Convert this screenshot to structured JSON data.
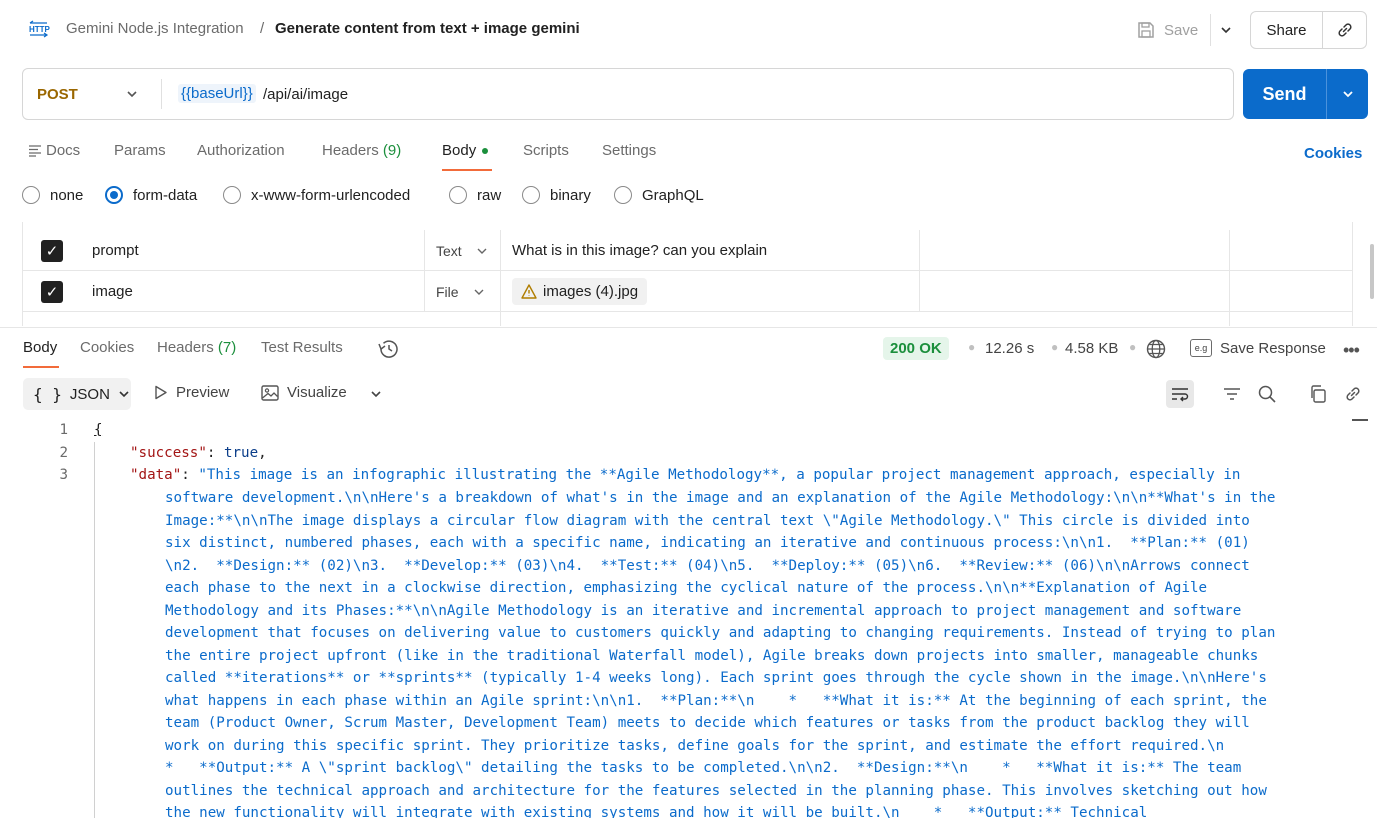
{
  "header": {
    "collection": "Gemini Node.js Integration",
    "separator": "/",
    "request_name": "Generate content from text + image gemini",
    "save_label": "Save",
    "share_label": "Share"
  },
  "request": {
    "method": "POST",
    "url_variable": "{{baseUrl}}",
    "url_path": "/api/ai/image",
    "send_label": "Send"
  },
  "request_tabs": [
    {
      "label": "Docs"
    },
    {
      "label": "Params"
    },
    {
      "label": "Authorization"
    },
    {
      "label": "Headers",
      "count": "(9)"
    },
    {
      "label": "Body",
      "active": true
    },
    {
      "label": "Scripts"
    },
    {
      "label": "Settings"
    }
  ],
  "cookies_label": "Cookies",
  "body_types": [
    "none",
    "form-data",
    "x-www-form-urlencoded",
    "raw",
    "binary",
    "GraphQL"
  ],
  "body_type_selected": "form-data",
  "form_rows": [
    {
      "checked": true,
      "key": "prompt",
      "type": "Text",
      "value": "What is in this image? can you explain"
    },
    {
      "checked": true,
      "key": "image",
      "type": "File",
      "value": "images (4).jpg"
    }
  ],
  "response": {
    "tabs": [
      {
        "label": "Body",
        "active": true
      },
      {
        "label": "Cookies"
      },
      {
        "label": "Headers",
        "count": "(7)"
      },
      {
        "label": "Test Results"
      }
    ],
    "status": "200 OK",
    "time": "12.26 s",
    "size": "4.58 KB",
    "save_response_label": "Save Response",
    "format": "JSON",
    "preview_label": "Preview",
    "visualize_label": "Visualize"
  },
  "code": {
    "line_numbers": [
      "1",
      "2",
      "3"
    ],
    "open_brace": "{",
    "success_key": "\"success\"",
    "success_value": "true",
    "data_key": "\"data\"",
    "data_lines": [
      "\"This image is an infographic illustrating the **Agile Methodology**, a popular project management approach, especially in",
      "software development.\\n\\nHere's a breakdown of what's in the image and an explanation of the Agile Methodology:\\n\\n**What's in the",
      "Image:**\\n\\nThe image displays a circular flow diagram with the central text \\\"Agile Methodology.\\\" This circle is divided into",
      "six distinct, numbered phases, each with a specific name, indicating an iterative and continuous process:\\n\\n1.  **Plan:** (01)",
      "\\n2.  **Design:** (02)\\n3.  **Develop:** (03)\\n4.  **Test:** (04)\\n5.  **Deploy:** (05)\\n6.  **Review:** (06)\\n\\nArrows connect",
      "each phase to the next in a clockwise direction, emphasizing the cyclical nature of the process.\\n\\n**Explanation of Agile",
      "Methodology and its Phases:**\\n\\nAgile Methodology is an iterative and incremental approach to project management and software",
      "development that focuses on delivering value to customers quickly and adapting to changing requirements. Instead of trying to plan",
      "the entire project upfront (like in the traditional Waterfall model), Agile breaks down projects into smaller, manageable chunks",
      "called **iterations** or **sprints** (typically 1-4 weeks long). Each sprint goes through the cycle shown in the image.\\n\\nHere's",
      "what happens in each phase within an Agile sprint:\\n\\n1.  **Plan:**\\n    *   **What it is:** At the beginning of each sprint, the",
      "team (Product Owner, Scrum Master, Development Team) meets to decide which features or tasks from the product backlog they will",
      "work on during this specific sprint. They prioritize tasks, define goals for the sprint, and estimate the effort required.\\n",
      "*   **Output:** A \\\"sprint backlog\\\" detailing the tasks to be completed.\\n\\n2.  **Design:**\\n    *   **What it is:** The team",
      "outlines the technical approach and architecture for the features selected in the planning phase. This involves sketching out how",
      "the new functionality will integrate with existing systems and how it will be built.\\n    *   **Output:** Technical"
    ]
  }
}
